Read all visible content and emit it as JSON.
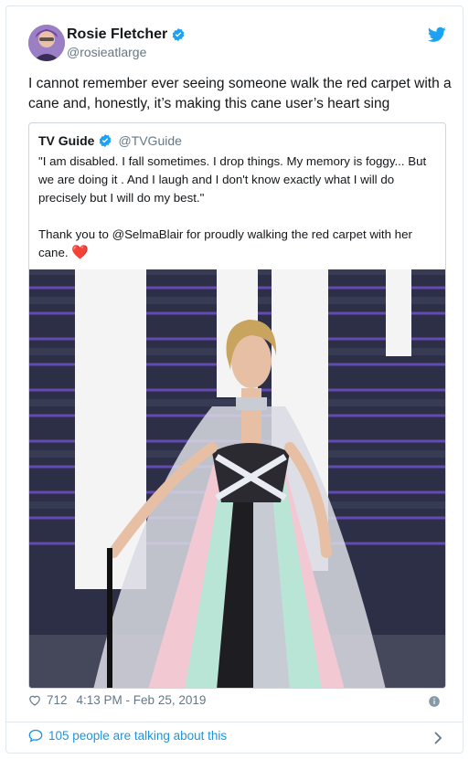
{
  "author": {
    "display_name": "Rosie Fletcher",
    "handle": "@rosieatlarge",
    "verified_icon": "verified-badge-icon",
    "avatar_icon": "avatar"
  },
  "tweet": {
    "text": "I cannot remember ever seeing someone walk the red carpet with a cane and, honestly, it’s making this cane user’s heart sing"
  },
  "quoted_tweet": {
    "display_name": "TV Guide",
    "handle": "@TVGuide",
    "text_part1": "\"I am disabled. I fall sometimes. I drop things. My memory is foggy... But we are doing it . And I laugh and I don't know exactly what I will do precisely but I will do my best.\"",
    "text_part2": "Thank you to @SelmaBlair for proudly walking the red carpet with her cane.",
    "emoji": "❤️"
  },
  "footer": {
    "likes": "712",
    "timestamp": "4:13 PM - Feb 25, 2019",
    "conversation": "105 people are talking about this"
  },
  "colors": {
    "accent": "#1da1f2",
    "link": "#1b95e0",
    "muted": "#657786",
    "heart": "#e0245e"
  }
}
